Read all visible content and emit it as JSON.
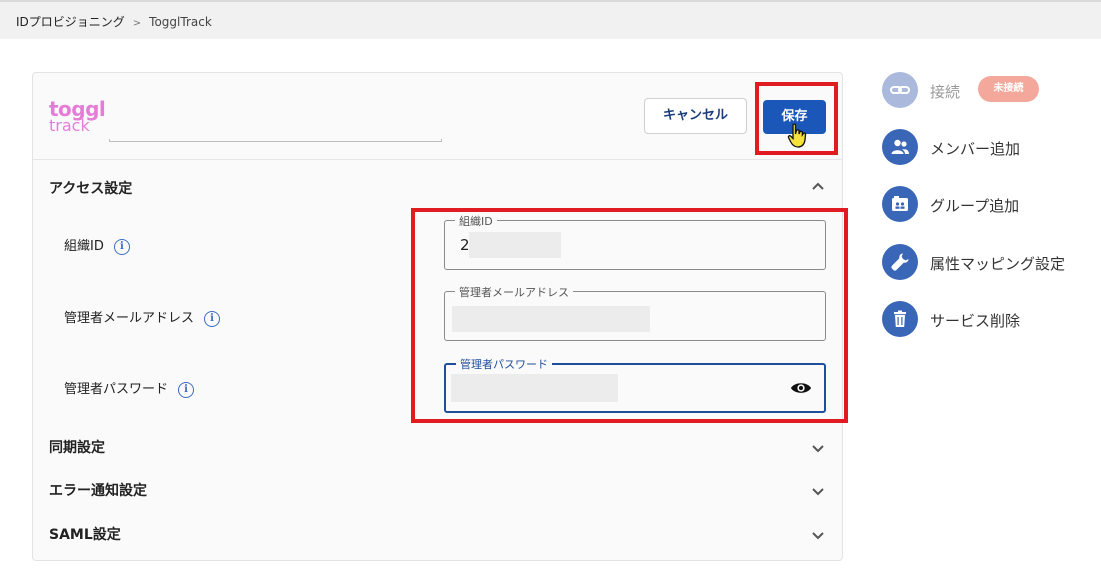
{
  "breadcrumb": {
    "root": "IDプロビジョニング",
    "separator": ">",
    "current": "TogglTrack"
  },
  "service": {
    "logo_top": "toggl",
    "logo_bottom": "track"
  },
  "toolbar": {
    "cancel_label": "キャンセル",
    "save_label": "保存"
  },
  "sections": {
    "access": "アクセス設定",
    "sync": "同期設定",
    "error_notify": "エラー通知設定",
    "saml": "SAML設定"
  },
  "fields": {
    "org_id": {
      "label": "組織ID",
      "legend": "組織ID",
      "value": "2"
    },
    "admin_email": {
      "label": "管理者メールアドレス",
      "legend": "管理者メールアドレス",
      "value": ""
    },
    "admin_password": {
      "label": "管理者パスワード",
      "legend": "管理者パスワード",
      "value": ""
    }
  },
  "info_icon": "i",
  "sidebar": {
    "connect": {
      "label": "接続",
      "badge": "未接続",
      "icon": "link-icon"
    },
    "add_member": {
      "label": "メンバー追加",
      "icon": "people-icon"
    },
    "add_group": {
      "label": "グループ追加",
      "icon": "group-icon"
    },
    "attr_mapping": {
      "label": "属性マッピング設定",
      "icon": "wrench-icon"
    },
    "delete_service": {
      "label": "サービス削除",
      "icon": "trash-icon"
    }
  },
  "colors": {
    "primary": "#1a57b8",
    "highlight": "#e01b22",
    "badge": "#f4a89b",
    "logo": "#e57cd8"
  }
}
